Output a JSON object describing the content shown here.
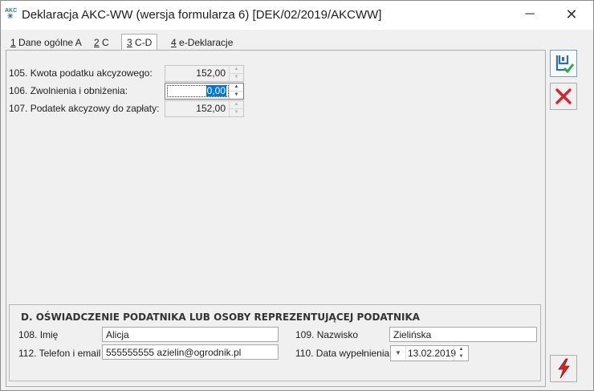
{
  "window": {
    "title": "Deklaracja AKC-WW (wersja formularza 6) [DEK/02/2019/AKCWW]",
    "app_icon_text": "AKC",
    "minimize_glyph": "─",
    "close_glyph": "✕"
  },
  "tabs": [
    {
      "key": "1",
      "label": " Dane ogólne A"
    },
    {
      "key": "2",
      "label": " C"
    },
    {
      "key": "3",
      "label": " C-D"
    },
    {
      "key": "4",
      "label": " e-Deklaracje"
    }
  ],
  "fields": {
    "f105": {
      "label": "105. Kwota podatku akcyzowego:",
      "value": "152,00"
    },
    "f106": {
      "label": "106. Zwolnienia i obniżenia:",
      "value": "0,00"
    },
    "f107": {
      "label": "107. Podatek akcyzowy do zapłaty:",
      "value": "152,00"
    }
  },
  "section_d": {
    "title": "D. OŚWIADCZENIE PODATNIKA LUB OSOBY REPREZENTUJĄCEJ  PODATNIKA",
    "first_name_label": "108. Imię",
    "first_name_value": "Alicja",
    "last_name_label": "109. Nazwisko",
    "last_name_value": "Zielińska",
    "phone_email_label": "112. Telefon i email",
    "phone_email_value": "555555555 azielin@ogrodnik.pl",
    "date_label": "110. Data wypełnienia",
    "date_value": "13.02.2019"
  },
  "icons": {
    "save": "save-icon",
    "cancel": "cancel-icon",
    "run": "lightning-icon"
  },
  "colors": {
    "selection": "#0078d7",
    "save_accent": "#2f6db5",
    "cancel_red": "#d9242b",
    "run_red": "#d9242b"
  }
}
